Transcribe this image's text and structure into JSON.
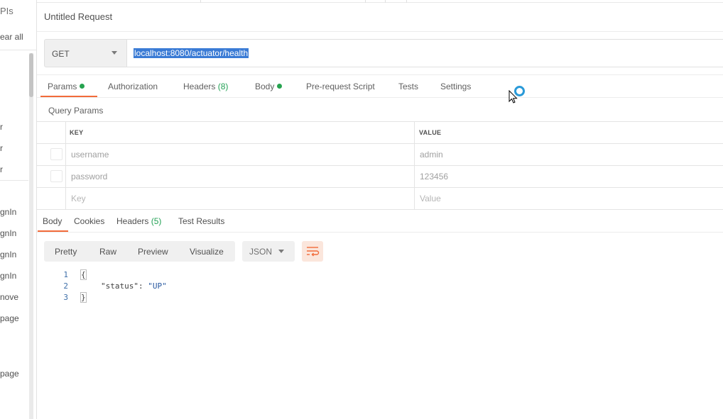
{
  "sidebar": {
    "apis_fragment": "PIs",
    "clear_all_fragment": "ear all",
    "history_items": [
      "r",
      "r",
      "r",
      "gnIn",
      "gnIn",
      "gnIn",
      "gnIn",
      "nove",
      "page",
      "page"
    ]
  },
  "request": {
    "title": "Untitled Request",
    "method": "GET",
    "url": "localhost:8080/actuator/health"
  },
  "request_tabs": {
    "params": "Params",
    "authorization": "Authorization",
    "headers": "Headers",
    "headers_count": "(8)",
    "body": "Body",
    "pre_request": "Pre-request Script",
    "tests": "Tests",
    "settings": "Settings"
  },
  "query_params": {
    "title": "Query Params",
    "key_header": "KEY",
    "value_header": "VALUE",
    "rows": [
      {
        "key": "username",
        "value": "admin"
      },
      {
        "key": "password",
        "value": "123456"
      }
    ],
    "new_key_placeholder": "Key",
    "new_value_placeholder": "Value"
  },
  "response_tabs": {
    "body": "Body",
    "cookies": "Cookies",
    "headers": "Headers",
    "headers_count": "(5)",
    "test_results": "Test Results"
  },
  "response_toolbar": {
    "pretty": "Pretty",
    "raw": "Raw",
    "preview": "Preview",
    "visualize": "Visualize",
    "format": "JSON",
    "wrap_icon": "wrap-lines-icon"
  },
  "response_body": {
    "line_numbers": [
      "1",
      "2",
      "3"
    ],
    "open_brace": "{",
    "key": "\"status\"",
    "colon": ": ",
    "value": "\"UP\"",
    "close_brace": "}"
  },
  "colors": {
    "accent": "#f26b3a",
    "dot": "#26a34f",
    "selection": "#3a7bd5",
    "busy": "#2a9ad8"
  }
}
